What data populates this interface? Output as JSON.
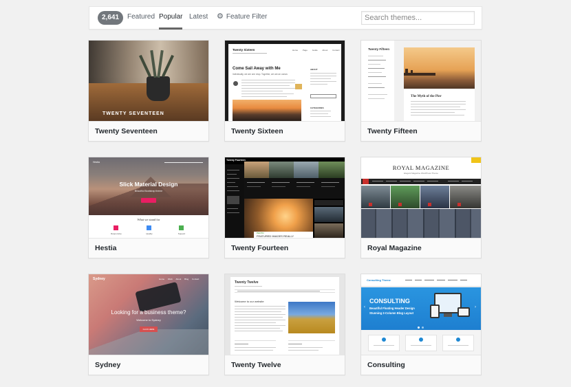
{
  "filter_bar": {
    "count": "2,641",
    "tabs": [
      "Featured",
      "Popular",
      "Latest"
    ],
    "current_tab": "Popular",
    "feature_filter": "Feature Filter",
    "search_placeholder": "Search themes..."
  },
  "themes": [
    {
      "name": "Twenty Seventeen",
      "preview": {
        "hero_title": "TWENTY SEVENTEEN"
      }
    },
    {
      "name": "Twenty Sixteen",
      "preview": {
        "site_title": "Twenty Sixteen",
        "post_title": "Come Sail Away with Me",
        "subtitle": "Individually, we are one drop. Together, we are an ocean.",
        "widget_about": "ABOUT",
        "widget_categories": "CATEGORIES",
        "nav": [
          "Home",
          "Page Guide",
          "About",
          "Contact"
        ]
      }
    },
    {
      "name": "Twenty Fifteen",
      "preview": {
        "site_title": "Twenty Fifteen",
        "post_title": "The Myth of the Pier"
      }
    },
    {
      "name": "Hestia",
      "preview": {
        "brand": "Hestia",
        "hero_title": "Slick Material Design",
        "hero_subtitle": "Beautiful Bootstrap theme",
        "section_title": "What we stand for",
        "features": [
          "Responsive",
          "Quality",
          "Support"
        ]
      }
    },
    {
      "name": "Twenty Fourteen",
      "preview": {
        "site_title": "Twenty Fourteen",
        "caption": "FEATURED IMAGES REALLY",
        "label": "PHOTO"
      }
    },
    {
      "name": "Royal Magazine",
      "preview": {
        "site_title": "ROYAL MAGAZINE",
        "tagline": "Elegant Magazine WordPress Theme"
      }
    },
    {
      "name": "Sydney",
      "preview": {
        "brand": "Sydney",
        "nav": [
          "Home",
          "Work",
          "About",
          "Blog",
          "Contact"
        ],
        "hero_title": "Looking for a business theme?",
        "hero_subtitle": "Welcome to Sydney",
        "button": "CLICK HERE"
      }
    },
    {
      "name": "Twenty Twelve",
      "preview": {
        "site_title": "Twenty Twelve",
        "post_title": "Welcome to our website"
      }
    },
    {
      "name": "Consulting",
      "preview": {
        "brand": "Consulting Theme",
        "hero_title": "CONSULTING",
        "hero_line1": "Beautiful Floating Header Design",
        "hero_line2": "Stunning 2-Column Blog Layout"
      }
    }
  ],
  "colors": {
    "accent_hestia": "#e91e63",
    "royal_red": "#c9302c",
    "consulting_blue": "#1e88d3",
    "t14_green": "#24890d"
  }
}
